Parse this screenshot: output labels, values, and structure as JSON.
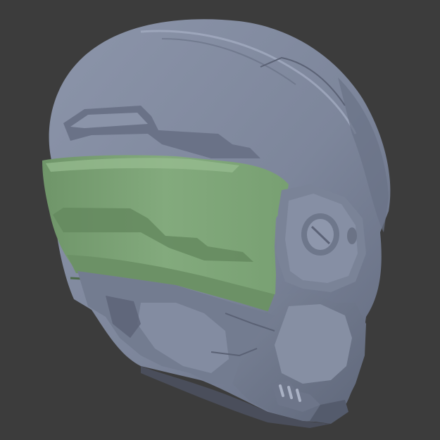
{
  "scene": {
    "background_color": "#3c3c3c",
    "model": "helmet-3d-render",
    "colors": {
      "shell": "#7e879c",
      "shell_light": "#97a0b5",
      "shell_dark": "#5d6477",
      "shell_shadow": "#4a5060",
      "visor": "#79a074",
      "visor_light": "#8fb589",
      "visor_dark": "#5b7d57"
    }
  }
}
